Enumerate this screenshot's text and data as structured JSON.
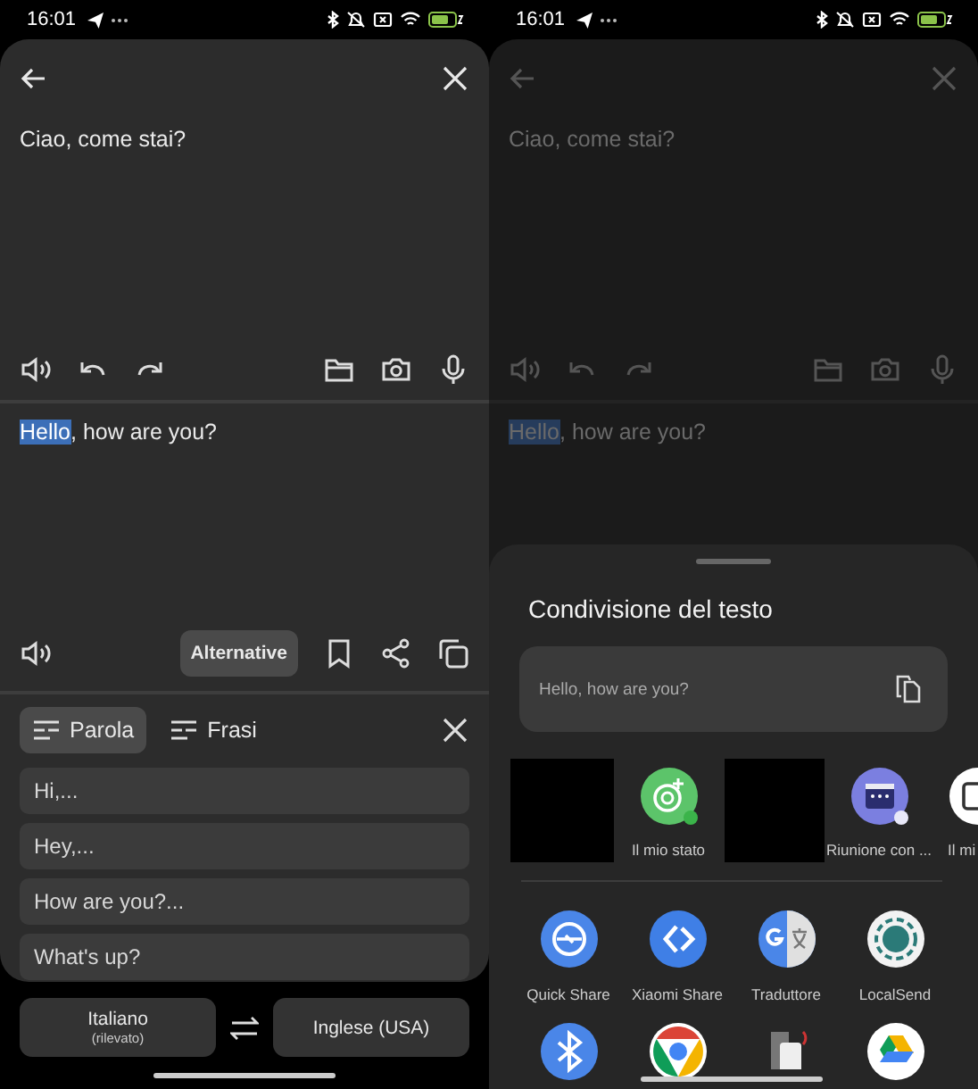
{
  "left_screen": {
    "status_bar": {
      "time": "16:01"
    },
    "source": {
      "text": "Ciao, come stai?"
    },
    "result": {
      "segments": [
        {
          "text": "Hello",
          "selected": true
        },
        {
          "text": ", how are you?",
          "selected": false
        }
      ]
    },
    "alternative_button": {
      "label": "Alternative",
      "active": true
    },
    "tabs": [
      {
        "label": "Parola",
        "selected": true
      },
      {
        "label": "Frasi",
        "selected": false
      }
    ],
    "alternatives": [
      "Hi,...",
      "Hey,...",
      "How are you?...",
      "What's up?"
    ],
    "languages": {
      "source": {
        "label": "Italiano",
        "note": "(rilevato)"
      },
      "target": {
        "label": "Inglese (USA)"
      }
    }
  },
  "right_screen": {
    "status_bar": {
      "time": "16:01"
    },
    "background": {
      "source_text": "Ciao, come stai?",
      "result_segments": [
        {
          "text": "Hello",
          "selected": true
        },
        {
          "text": ", how are you?",
          "selected": false
        }
      ]
    },
    "share_sheet": {
      "title": "Condivisione del testo",
      "preview": "Hello, how are you?",
      "contacts": [
        {
          "kind": "redacted"
        },
        {
          "kind": "status",
          "label": "Il mio stato"
        },
        {
          "kind": "redacted"
        },
        {
          "kind": "calendar",
          "label": "Riunione con ..."
        },
        {
          "kind": "window",
          "label": "Il mi"
        }
      ],
      "apps": [
        {
          "kind": "quick-share",
          "label": "Quick Share"
        },
        {
          "kind": "xiaomi-share",
          "label": "Xiaomi Share"
        },
        {
          "kind": "translate",
          "label": "Traduttore"
        },
        {
          "kind": "localsend",
          "label": "LocalSend"
        }
      ],
      "apps_row_2": [
        {
          "kind": "bluetooth"
        },
        {
          "kind": "chrome"
        },
        {
          "kind": "device"
        },
        {
          "kind": "drive"
        }
      ]
    }
  }
}
